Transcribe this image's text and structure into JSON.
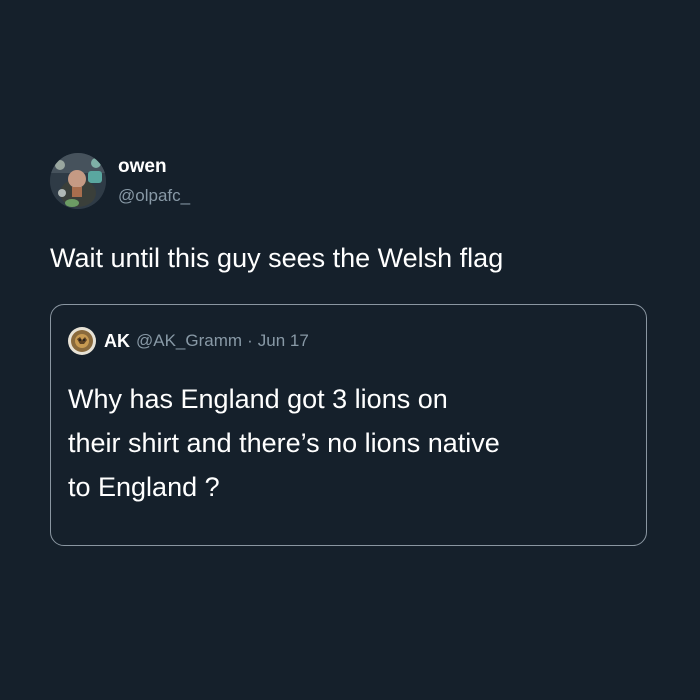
{
  "tweet": {
    "author": {
      "display_name": "owen",
      "handle": "@olpafc_"
    },
    "text": "Wait until this guy sees the Welsh flag"
  },
  "quoted_tweet": {
    "author": {
      "display_name": "AK",
      "handle": "@AK_Gramm"
    },
    "separator": "·",
    "date": "Jun 17",
    "text_lines": [
      "Why has England got 3 lions on",
      "their shirt and there’s no lions native",
      "to England ?"
    ]
  },
  "colors": {
    "background": "#15202b",
    "primary_text": "#ffffff",
    "secondary_text": "#8899a6",
    "card_border": "#8a96a1"
  },
  "icons": {
    "author_avatar": "avatar-photo",
    "quoted_author_avatar": "avatar-photo"
  }
}
